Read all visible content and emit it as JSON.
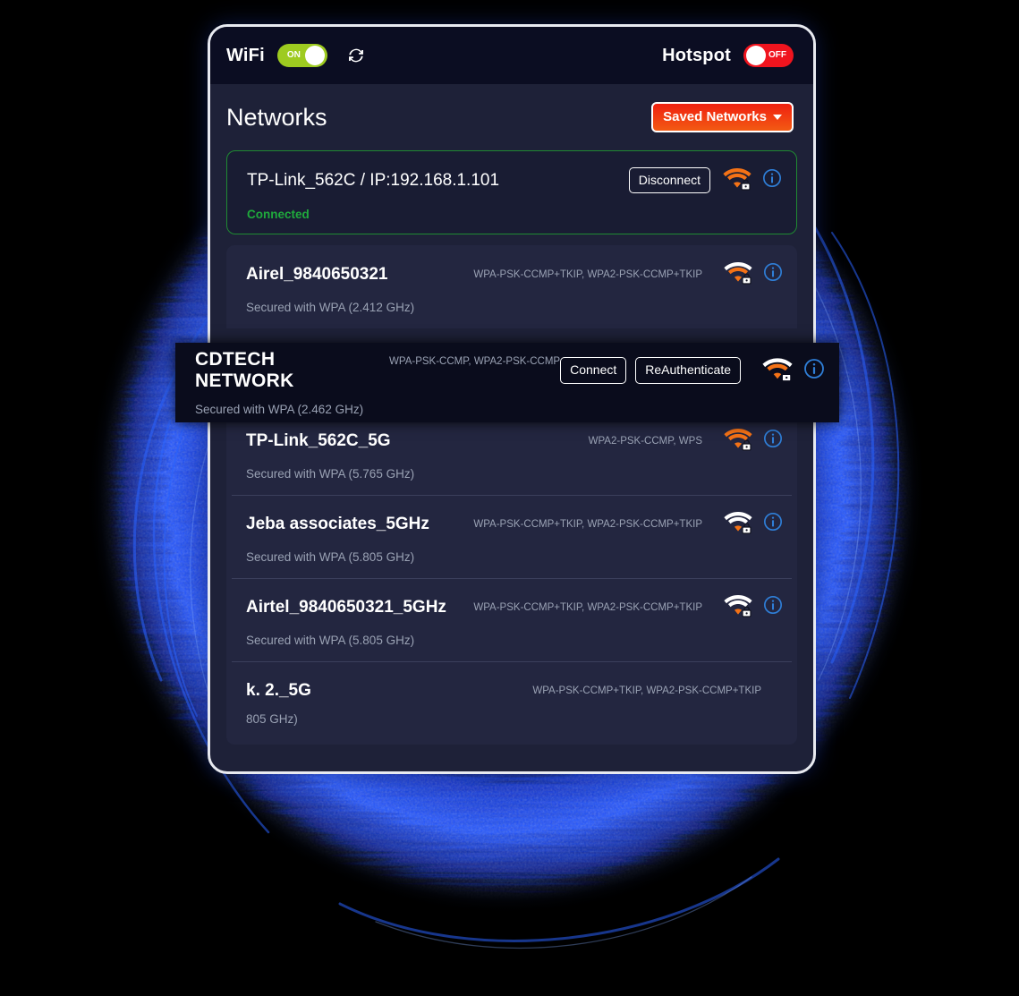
{
  "colors": {
    "accent_orange": "#f47216",
    "toggle_on_green": "#9ecb20",
    "toggle_off_red": "#f0141e",
    "connected_green": "#1faa3c",
    "info_blue": "#2f7fd8",
    "panel_bg": "#1e2138",
    "topbar_bg": "#0b0d22",
    "row_bg": "#232640",
    "overlay_bg": "#0a0c1c",
    "saved_btn_gradient_from": "#f02010",
    "saved_btn_gradient_to": "#f25b13",
    "background": "#000000",
    "ring_blue": "#1540f0"
  },
  "topbar": {
    "wifi_label": "WiFi",
    "wifi_toggle_state": "ON",
    "hotspot_label": "Hotspot",
    "hotspot_toggle_state": "OFF",
    "refresh_icon": "refresh-icon"
  },
  "header": {
    "title": "Networks",
    "saved_networks_label": "Saved Networks"
  },
  "connected": {
    "ssid": "TP-Link_562C / IP:192.168.1.101",
    "status": "Connected",
    "disconnect_label": "Disconnect",
    "signal": "strong",
    "secured": true
  },
  "networks": [
    {
      "ssid": "Airel_9840650321",
      "capabilities": "WPA-PSK-CCMP+TKIP, WPA2-PSK-CCMP+TKIP",
      "detail": "Secured with WPA (2.412 GHz)",
      "signal": "medium-high",
      "secured": true
    },
    {
      "ssid": "TP-Link_562C_5G",
      "capabilities": "WPA2-PSK-CCMP, WPS",
      "detail": "Secured with WPA (5.765 GHz)",
      "signal": "strong",
      "secured": true
    },
    {
      "ssid": "Jeba associates_5GHz",
      "capabilities": "WPA-PSK-CCMP+TKIP, WPA2-PSK-CCMP+TKIP",
      "detail": "Secured with WPA (5.805 GHz)",
      "signal": "weak",
      "secured": true
    },
    {
      "ssid": "Airtel_9840650321_5GHz",
      "capabilities": "WPA-PSK-CCMP+TKIP, WPA2-PSK-CCMP+TKIP",
      "detail": "Secured with WPA (5.805 GHz)",
      "signal": "weak",
      "secured": true
    },
    {
      "ssid": "k. 2._5G",
      "capabilities": "WPA-PSK-CCMP+TKIP, WPA2-PSK-CCMP+TKIP",
      "detail": "805 GHz)",
      "signal": "weak",
      "secured": true
    }
  ],
  "overlay": {
    "ssid": "CDTECH NETWORK",
    "capabilities": "WPA-PSK-CCMP, WPA2-PSK-CCMP",
    "detail": "Secured with WPA (2.462 GHz)",
    "connect_label": "Connect",
    "reauthenticate_label": "ReAuthenticate",
    "signal": "medium-high",
    "secured": true
  }
}
